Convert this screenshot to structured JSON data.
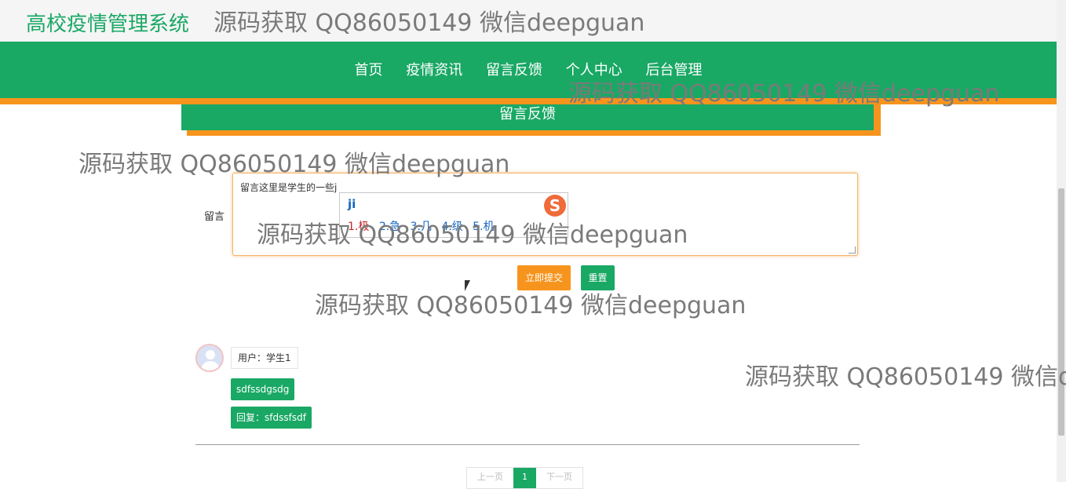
{
  "brand": "高校疫情管理系统",
  "watermark": "源码获取 QQ86050149 微信deepguan",
  "watermark_partial": "源码获取 QQ86050149 微信d",
  "nav": {
    "items": [
      "首页",
      "疫情资讯",
      "留言反馈",
      "个人中心",
      "后台管理"
    ]
  },
  "section_title": "留言反馈",
  "form": {
    "label": "留言",
    "value": "留言这里是学生的一些j",
    "submit": "立即提交",
    "reset": "重置"
  },
  "ime": {
    "composition": "ji",
    "candidates": [
      "1.极",
      "2.急",
      "3.几",
      "4.级",
      "5.机"
    ],
    "logo": "S"
  },
  "comment": {
    "user": "用户：学生1",
    "content": "sdfssdgsdg",
    "reply": "回复：sfdssfsdf"
  },
  "pager": {
    "prev": "上一页",
    "current": "1",
    "next": "下一页"
  }
}
